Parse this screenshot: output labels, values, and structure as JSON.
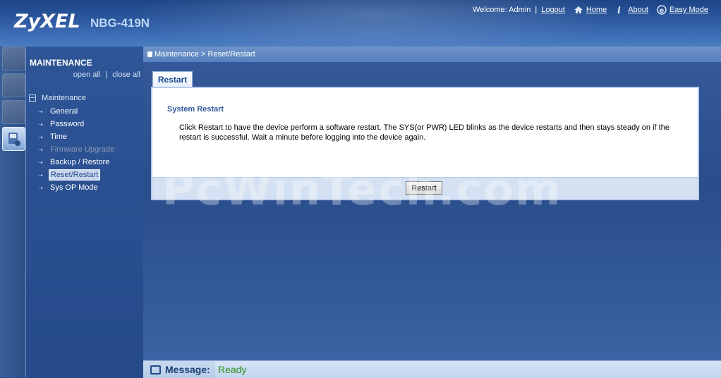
{
  "header": {
    "brand": "ZyXEL",
    "model": "NBG-419N",
    "welcome_text": "Welcome: Admin",
    "separator": "|",
    "logout_label": "Logout",
    "home_label": "Home",
    "about_label": "About",
    "easy_mode_label": "Easy Mode"
  },
  "sidebar": {
    "title": "MAINTENANCE",
    "open_all": "open all",
    "separator": "|",
    "close_all": "close all",
    "root_label": "Maintenance",
    "items": [
      {
        "label": "General",
        "state": "normal"
      },
      {
        "label": "Password",
        "state": "normal"
      },
      {
        "label": "Time",
        "state": "normal"
      },
      {
        "label": "Firmware Upgrade",
        "state": "disabled"
      },
      {
        "label": "Backup / Restore",
        "state": "normal"
      },
      {
        "label": "Reset/Restart",
        "state": "selected"
      },
      {
        "label": "Sys OP Mode",
        "state": "normal"
      }
    ]
  },
  "breadcrumb": "Maintenance > Reset/Restart",
  "tab": {
    "label": "Restart"
  },
  "panel": {
    "title": "System Restart",
    "description": "Click Restart to have the device perform a software restart. The SYS(or PWR) LED blinks as the device restarts and then stays steady on if the restart is successful. Wait a minute before logging into the device again.",
    "restart_button": "Restart"
  },
  "watermark": "PcWinTech.com",
  "status": {
    "label": "Message:",
    "value": "Ready"
  },
  "colors": {
    "header": "#2d5aa0",
    "status_ready": "#2f8b1f",
    "panel_title": "#2f5595"
  }
}
